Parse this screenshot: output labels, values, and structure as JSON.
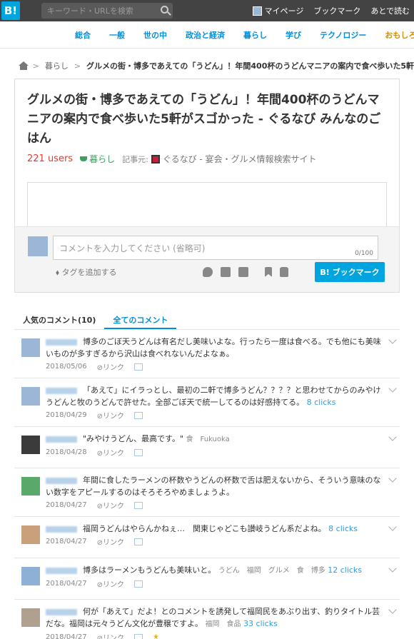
{
  "header": {
    "logo": "B!",
    "search_placeholder": "キーワード・URLを検索",
    "nav": [
      "マイページ",
      "ブックマーク",
      "あとで読む"
    ]
  },
  "categories": [
    {
      "label": "総合",
      "current": false
    },
    {
      "label": "一般",
      "current": false
    },
    {
      "label": "世の中",
      "current": false
    },
    {
      "label": "政治と経済",
      "current": false
    },
    {
      "label": "暮らし",
      "current": false
    },
    {
      "label": "学び",
      "current": false
    },
    {
      "label": "テクノロジー",
      "current": false
    },
    {
      "label": "おもしろ",
      "current": true
    }
  ],
  "breadcrumb": {
    "category": "暮らし",
    "current": "グルメの街・博多であえての「うどん」！年間400杯のうどんマニアの案内で食べ歩いた5軒"
  },
  "entry": {
    "title": "グルメの街・博多であえての「うどん」！年間400杯のうどんマニアの案内で食べ歩いた5軒がスゴかった - ぐるなび みんなのごはん",
    "users": "221 users",
    "category": "暮らし",
    "source_label": "記事元:",
    "source": "ぐるなび - 宴会・グルメ情報検索サイト"
  },
  "comment_box": {
    "placeholder": "コメントを入力してください (省略可)",
    "counter": "0/100",
    "add_tag": "タグを追加する",
    "bookmark_button": "B! ブックマーク"
  },
  "tabs": [
    "人気のコメント(10)",
    "全てのコメント"
  ],
  "comments": [
    {
      "text": "博多のごぼ天うどんは有名だし美味いよな。行ったら一度は食べる。でも他にも美味いものが多すぎるから沢山は食べれないんだよなぁ。",
      "date": "2018/05/06",
      "tags": "",
      "clicks": ""
    },
    {
      "text": "「あえて」にイラっとし、最初の二軒で博多うどん？？？？と思わせてからのみやけうどんと牧のうどんで許せた。全部ごぼ天で統一してるのは好感持てる。",
      "date": "2018/04/29",
      "tags": "",
      "clicks": "8 clicks"
    },
    {
      "text": "\"みやけうどん、最高です。\"",
      "date": "2018/04/28",
      "tags": "食　Fukuoka",
      "clicks": ""
    },
    {
      "text": "年間に食したラーメンの杯数やうどんの杯数で舌は肥えないから、そういう意味のない数字をアピールするのはそろそろやめましょうよ。",
      "date": "2018/04/27",
      "tags": "",
      "clicks": ""
    },
    {
      "text": "福岡うどんはやらんかねぇ…　関東じゃどこも讃岐うどん系だよね。",
      "date": "2018/04/27",
      "tags": "",
      "clicks": "8 clicks"
    },
    {
      "text": "博多はラーメンもうどんも美味いと。",
      "date": "2018/04/27",
      "tags": "うどん　福岡　グルメ　食　博多",
      "clicks": "12 clicks"
    },
    {
      "text": "何が「あえて」だよ！とのコメントを誘発して福岡民をあぶり出す、釣りタイトル芸だな。福岡は元々うどん文化が豊穣ですよ。",
      "date": "2018/04/27",
      "tags": "福岡　食品",
      "clicks": "33 clicks"
    }
  ],
  "link_label": "リンク",
  "avatar_colors": [
    "#9cb6d8",
    "#9cb6d8",
    "#3b3b3b",
    "#5aa86a",
    "#c9a07a",
    "#8fb0d6",
    "#b0a090"
  ]
}
